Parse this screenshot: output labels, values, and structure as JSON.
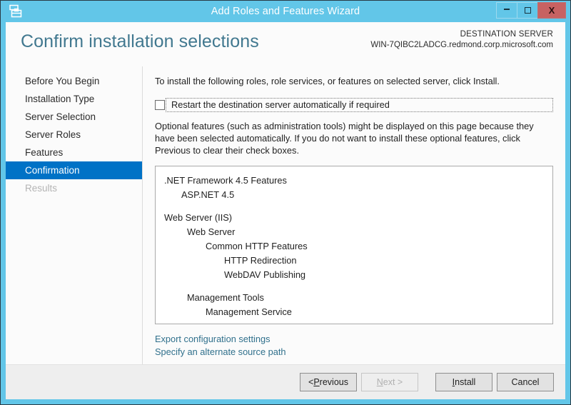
{
  "window": {
    "title": "Add Roles and Features Wizard",
    "icon": "server-wizard-icon",
    "controls": {
      "minimize_label": "—",
      "maximize_label": "",
      "close_label": "X"
    },
    "colors": {
      "chrome_blue": "#62c6e8",
      "accent_blue": "#0072c6",
      "heading_blue": "#41788f",
      "close_red": "#c76262",
      "link_blue": "#30708c"
    }
  },
  "header": {
    "page_title": "Confirm installation selections",
    "destination_label": "DESTINATION SERVER",
    "destination_server": "WIN-7QIBC2LADCG.redmond.corp.microsoft.com"
  },
  "sidebar": {
    "items": [
      {
        "label": "Before You Begin",
        "state": "normal"
      },
      {
        "label": "Installation Type",
        "state": "normal"
      },
      {
        "label": "Server Selection",
        "state": "normal"
      },
      {
        "label": "Server Roles",
        "state": "normal"
      },
      {
        "label": "Features",
        "state": "normal"
      },
      {
        "label": "Confirmation",
        "state": "active"
      },
      {
        "label": "Results",
        "state": "disabled"
      }
    ]
  },
  "main": {
    "intro_text": "To install the following roles, role services, or features on selected server, click Install.",
    "restart_checkbox": {
      "label": "Restart the destination server automatically if required",
      "checked": false,
      "focused": true
    },
    "optional_text": "Optional features (such as administration tools) might be displayed on this page because they have been selected automatically. If you do not want to install these optional features, click Previous to clear their check boxes.",
    "features": [
      {
        "label": ".NET Framework 4.5 Features",
        "level": 0,
        "gap": false
      },
      {
        "label": "ASP.NET 4.5",
        "level": 1,
        "gap": false
      },
      {
        "label": "Web Server (IIS)",
        "level": 0,
        "gap": true
      },
      {
        "label": "Web Server",
        "level": 2,
        "gap": false
      },
      {
        "label": "Common HTTP Features",
        "level": 3,
        "gap": false
      },
      {
        "label": "HTTP Redirection",
        "level": 4,
        "gap": false
      },
      {
        "label": "WebDAV Publishing",
        "level": 4,
        "gap": false
      },
      {
        "label": "Management Tools",
        "level": 2,
        "gap": true
      },
      {
        "label": "Management Service",
        "level": 3,
        "gap": false
      }
    ],
    "links": [
      {
        "label": "Export configuration settings"
      },
      {
        "label": "Specify an alternate source path"
      }
    ]
  },
  "footer": {
    "buttons": [
      {
        "label": "< Previous",
        "accel": "P",
        "state": "enabled"
      },
      {
        "label": "Next >",
        "accel": "N",
        "state": "disabled"
      },
      {
        "label": "Install",
        "accel": "I",
        "state": "enabled"
      },
      {
        "label": "Cancel",
        "accel": "",
        "state": "enabled"
      }
    ]
  }
}
